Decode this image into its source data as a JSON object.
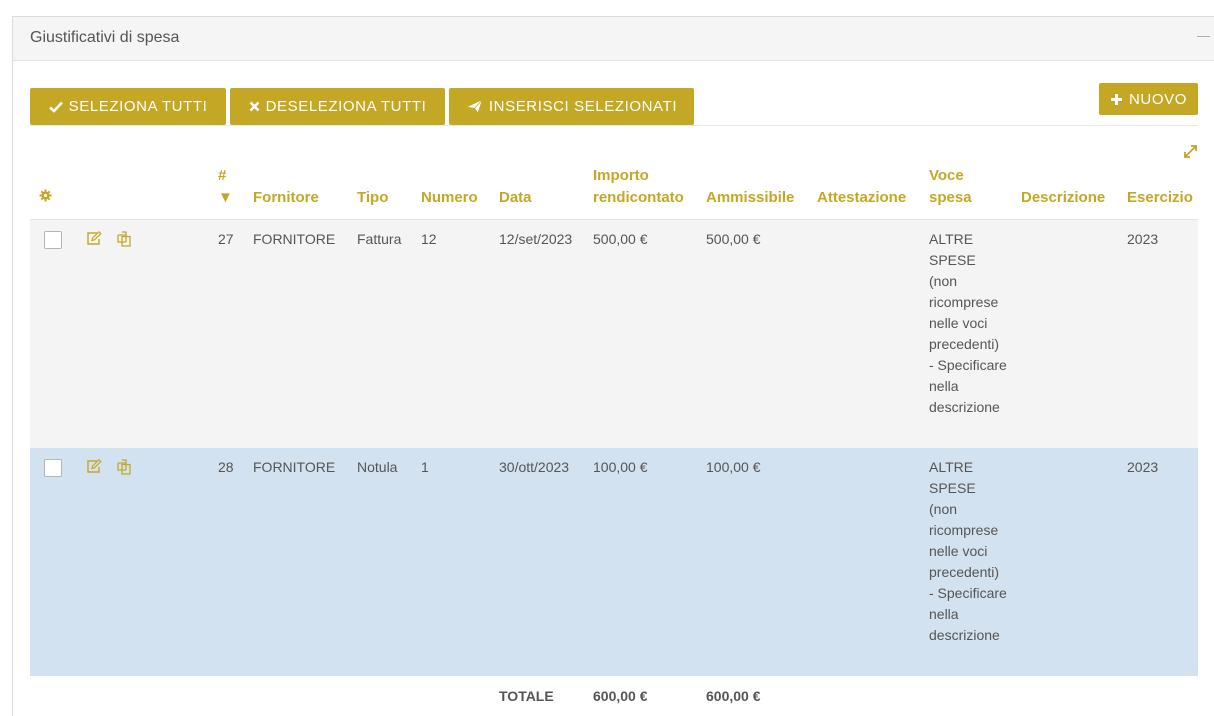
{
  "panel": {
    "title": "Giustificativi di spesa"
  },
  "toolbar": {
    "select_all_label": "SELEZIONA TUTTI",
    "deselect_all_label": "DESELEZIONA TUTTI",
    "insert_selected_label": "INSERISCI SELEZIONATI",
    "new_label": "NUOVO"
  },
  "table": {
    "columns": {
      "id": "#",
      "sort_indicator": "▼",
      "fornitore": "Fornitore",
      "tipo": "Tipo",
      "numero": "Numero",
      "data": "Data",
      "importo": "Importo rendicontato",
      "ammissibile": "Ammissibile",
      "attestazione": "Attestazione",
      "voce": "Voce spesa",
      "descrizione": "Descrizione",
      "esercizio": "Esercizio"
    },
    "rows": [
      {
        "id": "27",
        "fornitore": "FORNITORE",
        "tipo": "Fattura",
        "numero": "12",
        "data": "12/set/2023",
        "importo": "500,00 €",
        "ammissibile": "500,00 €",
        "attestazione": "",
        "voce": "ALTRE SPESE (non ricomprese nelle voci precedenti) - Specificare nella descrizione",
        "descrizione": "",
        "esercizio": "2023"
      },
      {
        "id": "28",
        "fornitore": "FORNITORE",
        "tipo": "Notula",
        "numero": "1",
        "data": "30/ott/2023",
        "importo": "100,00 €",
        "ammissibile": "100,00 €",
        "attestazione": "",
        "voce": "ALTRE SPESE (non ricomprese nelle voci precedenti) - Specificare nella descrizione",
        "descrizione": "",
        "esercizio": "2023"
      }
    ],
    "totals": {
      "label": "TOTALE",
      "importo": "600,00 €",
      "ammissibile": "600,00 €"
    }
  },
  "colors": {
    "accent": "#c4a825",
    "header_bg": "#f5f5f5",
    "row_odd_bg": "#f4f4f4",
    "row_selected_bg": "#d3e2f0"
  },
  "icons": {
    "select_all": "check-icon",
    "deselect_all": "times-icon",
    "insert_selected": "paper-plane-icon",
    "new": "plus-icon",
    "settings": "gear-icon",
    "edit": "edit-icon",
    "duplicate": "copy-icon",
    "expand": "expand-icon",
    "collapse": "minus-icon"
  }
}
